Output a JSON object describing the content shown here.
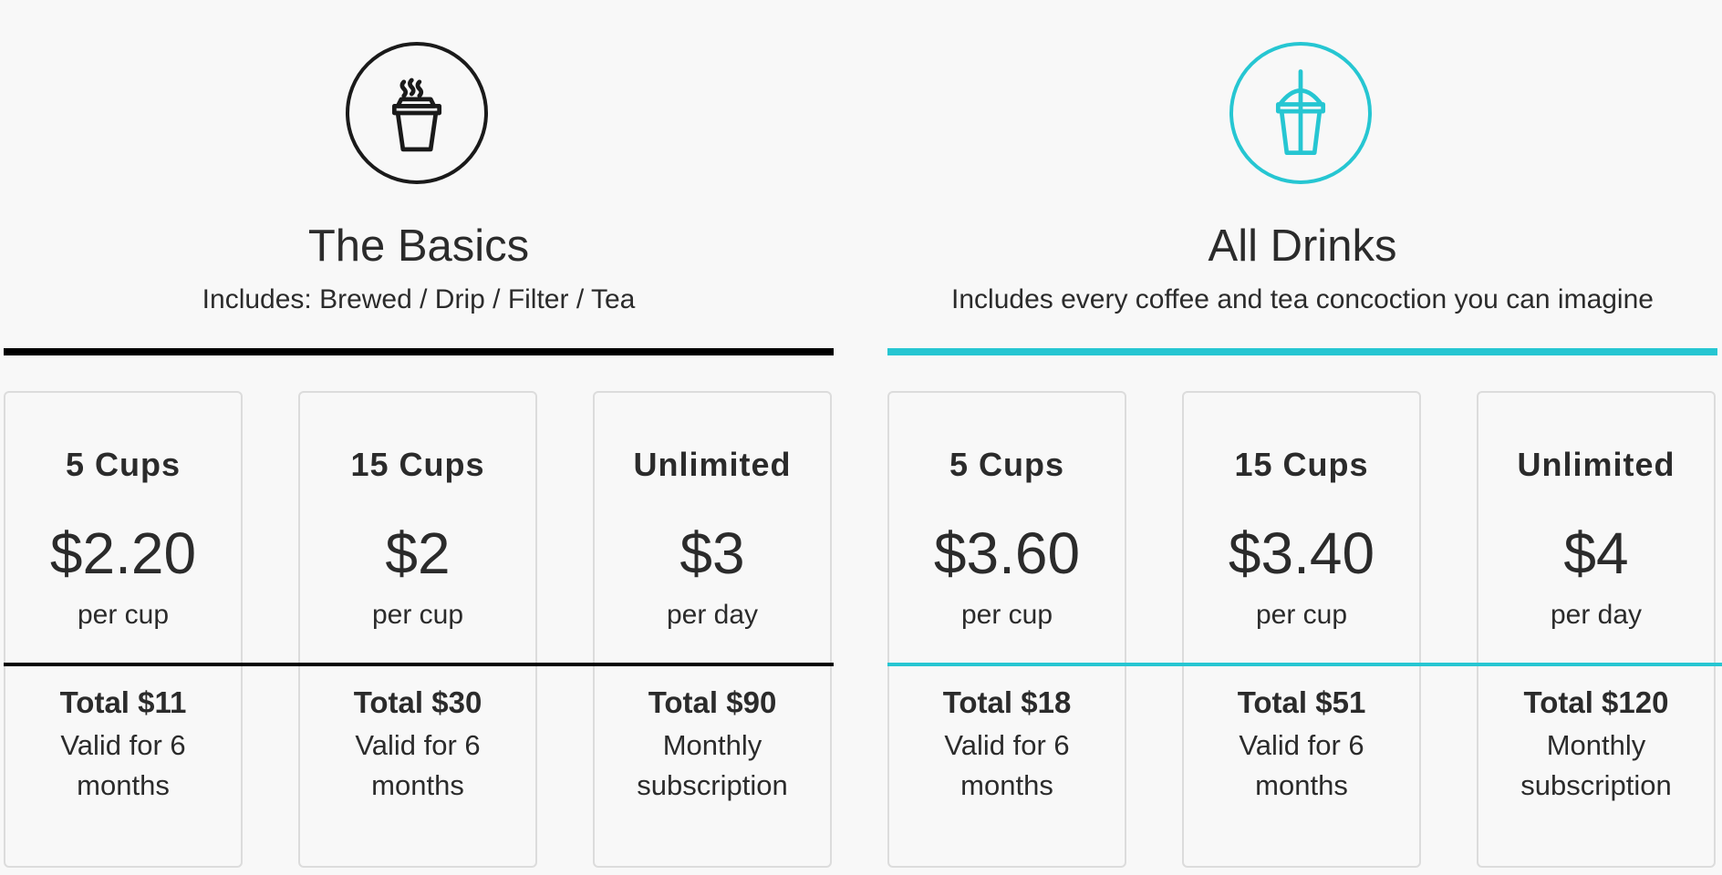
{
  "plans": [
    {
      "icon": "coffee-cup-icon",
      "accent_color": "#000000",
      "title": "The Basics",
      "subtitle": "Includes: Brewed / Drip / Filter / Tea",
      "options": [
        {
          "name": "5 Cups",
          "price": "$2.20",
          "unit": "per cup",
          "total": "Total $11",
          "validity": "Valid for 6 months"
        },
        {
          "name": "15 Cups",
          "price": "$2",
          "unit": "per cup",
          "total": "Total $30",
          "validity": "Valid for 6 months"
        },
        {
          "name": "Unlimited",
          "price": "$3",
          "unit": "per day",
          "total": "Total $90",
          "validity": "Monthly subscription"
        }
      ]
    },
    {
      "icon": "drink-with-straw-icon",
      "accent_color": "#26c6d2",
      "title": "All Drinks",
      "subtitle": "Includes every coffee and tea concoction you can imagine",
      "options": [
        {
          "name": "5 Cups",
          "price": "$3.60",
          "unit": "per cup",
          "total": "Total $18",
          "validity": "Valid for 6 months"
        },
        {
          "name": "15 Cups",
          "price": "$3.40",
          "unit": "per cup",
          "total": "Total $51",
          "validity": "Valid for 6 months"
        },
        {
          "name": "Unlimited",
          "price": "$4",
          "unit": "per day",
          "total": "Total $120",
          "validity": "Monthly subscription"
        }
      ]
    }
  ]
}
